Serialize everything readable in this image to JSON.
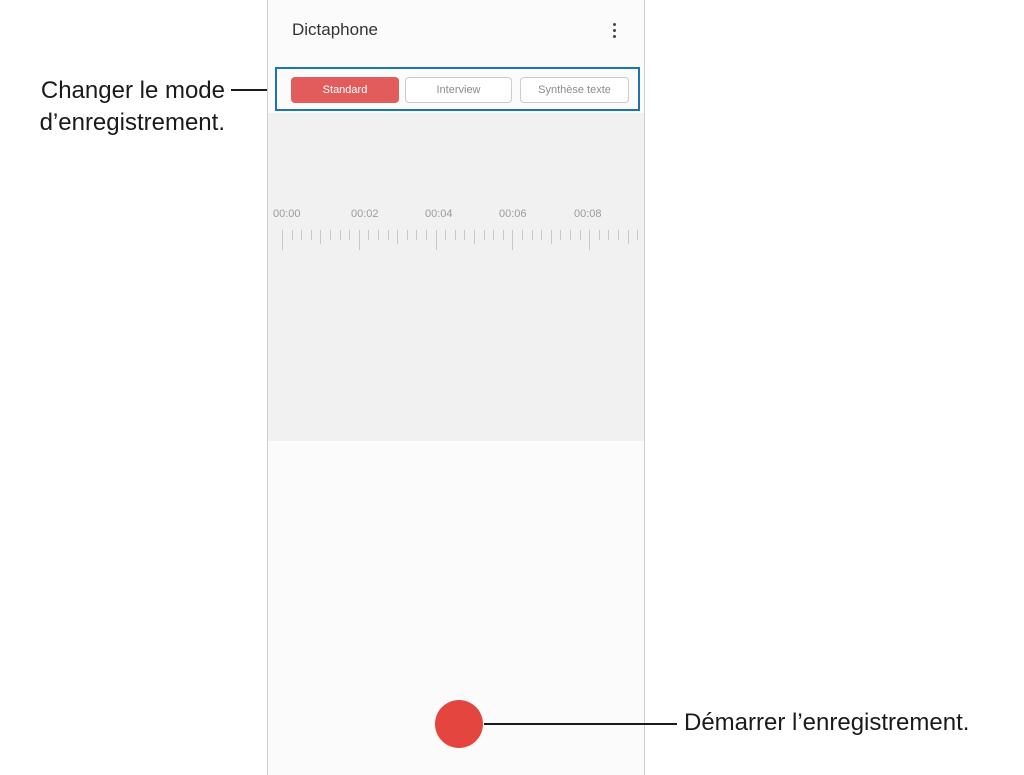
{
  "app": {
    "title": "Dictaphone",
    "menu_icon": "more-vertical-icon"
  },
  "modes": {
    "items": [
      {
        "label": "Standard",
        "active": true
      },
      {
        "label": "Interview",
        "active": false
      },
      {
        "label": "Synthèse texte",
        "active": false
      }
    ]
  },
  "timeline": {
    "labels": [
      "00:00",
      "00:02",
      "00:04",
      "00:06",
      "00:08"
    ]
  },
  "record": {
    "icon": "record-icon",
    "color": "#e5453f"
  },
  "callouts": {
    "mode_line1": "Changer le mode",
    "mode_line2": "d’enregistrement.",
    "record": "Démarrer l’enregistrement."
  },
  "colors": {
    "accent": "#e25c5c",
    "highlight_border": "#1b75b5"
  }
}
